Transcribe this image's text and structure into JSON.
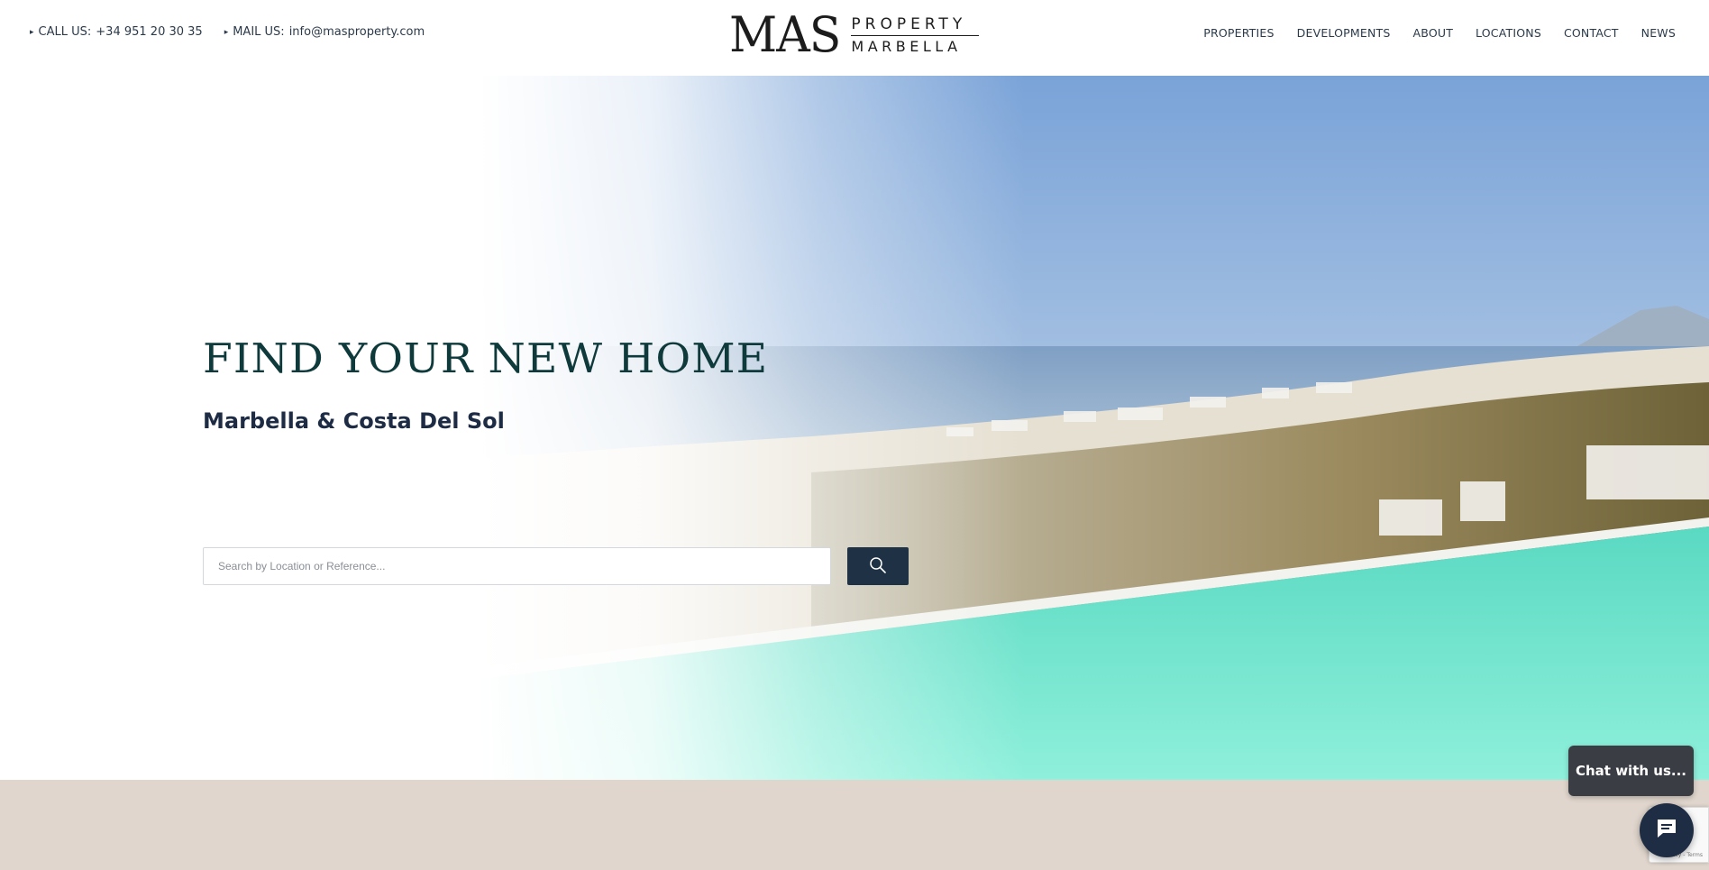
{
  "header": {
    "contact": {
      "call_label": "CALL US:",
      "call_value": "+34 951 20 30 35",
      "mail_label": "MAIL US:",
      "mail_value": "info@masproperty.com",
      "arrow_glyph": "▸"
    },
    "logo": {
      "mark": "MAS",
      "word_top": "PROPERTY",
      "word_bottom": "MARBELLA"
    },
    "nav": [
      {
        "label": "PROPERTIES"
      },
      {
        "label": "DEVELOPMENTS"
      },
      {
        "label": "ABOUT"
      },
      {
        "label": "LOCATIONS"
      },
      {
        "label": "CONTACT"
      },
      {
        "label": "NEWS"
      }
    ]
  },
  "hero": {
    "title": "FIND YOUR NEW HOME",
    "subtitle": "Marbella & Costa Del Sol",
    "search": {
      "placeholder": "Search by Location or Reference...",
      "value": "",
      "button_icon": "search-icon"
    }
  },
  "chat": {
    "bubble_text": "Chat with us...",
    "launcher_icon": "chat-icon"
  },
  "recaptcha": {
    "text": "Privacy - Terms"
  },
  "colors": {
    "navy": "#1f3145",
    "title_green": "#0f3a3c",
    "pool": "#5fe0c8",
    "band": "#e0d6cd",
    "chat_dark": "#3a3d44"
  }
}
